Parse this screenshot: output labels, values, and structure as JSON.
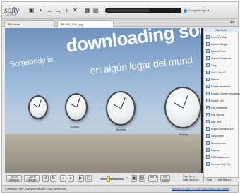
{
  "app": {
    "logo": "softy",
    "logo_sub": "Image Viewer"
  },
  "toolbar": {
    "image_search": "Google Image"
  },
  "tabs": [
    {
      "label": "Folder"
    },
    {
      "label": "IMG_0340.jpg"
    }
  ],
  "photo": {
    "banner_line1": "Somebody is",
    "banner_line2": "downloading somethin",
    "banner_line3": "en algún lugar del mund",
    "city_1": "Sydney",
    "city_2": "Mumbai",
    "city_3": "Beijing"
  },
  "panel": {
    "title": "My Tools",
    "tools": [
      "Send Via Mail",
      "Upload Google",
      "Upload Flickr",
      "Upload Facebook",
      "Crop",
      "Auto Crop ID",
      "Resize",
      "Rotate clockwise",
      "Rotate Counter clockwise",
      "Rotate 180",
      "Flip Horizontal",
      "Flip Vertical",
      "Add Text",
      "Bright/Contrast/Hue",
      "Gray Scale",
      "Monochrome",
      "Expose",
      "RGB Adjustment",
      "Remove Red Eye"
    ],
    "tab_tools": "Tools",
    "tab_history": "Edit History"
  },
  "bottom": {
    "btn_set_wallpaper": "Set as wallpaper",
    "btn_color_to_clipboard": "Color to clipboard",
    "btn_best_fit": "Best Fit",
    "btn_full_screen": "Full Screen",
    "page_up": "Page Up or ↑",
    "page_down": "Page Down or ↓",
    "zoom_level": 0.32
  },
  "status": {
    "file_info": "1 object(s) : IMG_0340.jpg  File Size 27060  1600x1200",
    "link": "Welcome to Use PV Free Photo Editing and Viewer"
  }
}
